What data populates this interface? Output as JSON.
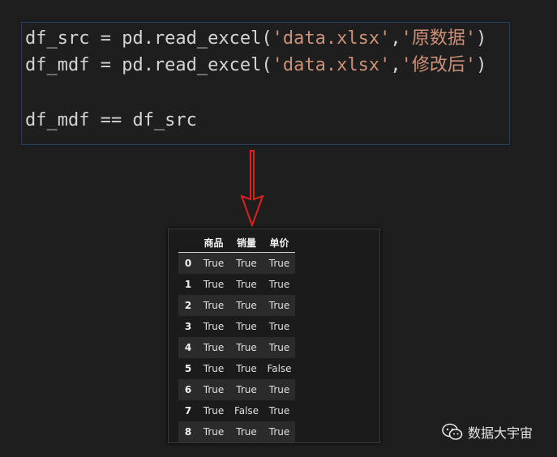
{
  "code": {
    "line1": {
      "pre": "df_src = pd.read_excel(",
      "s1": "'data.xlsx'",
      "sep": ",",
      "s2": "'原数据'",
      "post": ")"
    },
    "line2": {
      "pre": "df_mdf = pd.read_excel(",
      "s1": "'data.xlsx'",
      "sep": ",",
      "s2": "'修改后'",
      "post": ")"
    },
    "line3": "df_mdf == df_src"
  },
  "colors": {
    "string": "#ce9178",
    "code_text": "#d4d4d4",
    "arrow": "#e02020"
  },
  "icons": {
    "arrow": "down-arrow-icon",
    "watermark": "wechat-icon"
  },
  "table": {
    "columns": [
      "商品",
      "销量",
      "单价"
    ],
    "rows": [
      {
        "index": "0",
        "cells": [
          "True",
          "True",
          "True"
        ]
      },
      {
        "index": "1",
        "cells": [
          "True",
          "True",
          "True"
        ]
      },
      {
        "index": "2",
        "cells": [
          "True",
          "True",
          "True"
        ]
      },
      {
        "index": "3",
        "cells": [
          "True",
          "True",
          "True"
        ]
      },
      {
        "index": "4",
        "cells": [
          "True",
          "True",
          "True"
        ]
      },
      {
        "index": "5",
        "cells": [
          "True",
          "True",
          "False"
        ]
      },
      {
        "index": "6",
        "cells": [
          "True",
          "True",
          "True"
        ]
      },
      {
        "index": "7",
        "cells": [
          "True",
          "False",
          "True"
        ]
      },
      {
        "index": "8",
        "cells": [
          "True",
          "True",
          "True"
        ]
      }
    ]
  },
  "watermark": {
    "text": "数据大宇宙"
  }
}
